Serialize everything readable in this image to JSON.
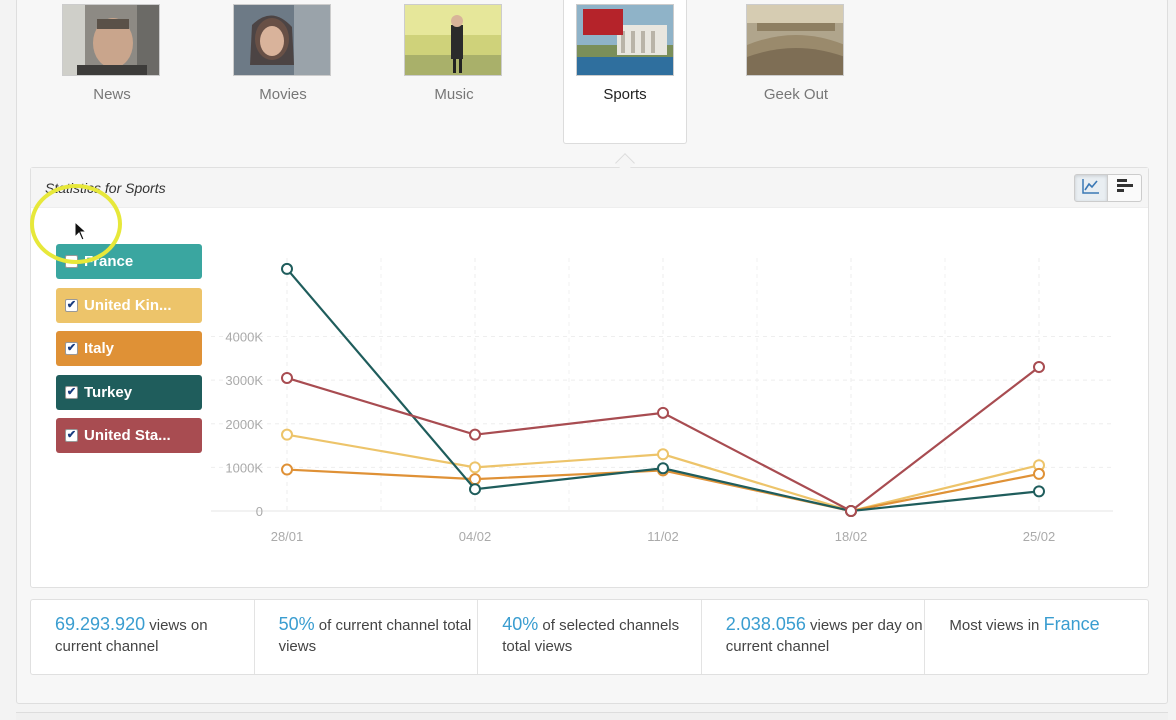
{
  "tabs": [
    {
      "label": "News",
      "active": false
    },
    {
      "label": "Movies",
      "active": false
    },
    {
      "label": "Music",
      "active": false
    },
    {
      "label": "Sports",
      "active": true
    },
    {
      "label": "Geek Out",
      "active": false
    }
  ],
  "panel": {
    "title": "Statistics for Sports"
  },
  "view_buttons": [
    {
      "icon": "line-chart-icon",
      "active": true
    },
    {
      "icon": "bar-chart-icon",
      "active": false
    }
  ],
  "legend": [
    {
      "label": "France",
      "checked": false,
      "color": "#3aa6a0"
    },
    {
      "label": "United Kin...",
      "checked": true,
      "color": "#edc46a"
    },
    {
      "label": "Italy",
      "checked": true,
      "color": "#df9136"
    },
    {
      "label": "Turkey",
      "checked": true,
      "color": "#1f5d5c"
    },
    {
      "label": "United Sta...",
      "checked": true,
      "color": "#a84c51"
    }
  ],
  "chart_data": {
    "type": "line",
    "x": [
      "28/01",
      "04/02",
      "11/02",
      "18/02",
      "25/02"
    ],
    "ytick_labels": [
      "0",
      "1000K",
      "2000K",
      "3000K",
      "4000K"
    ],
    "ytick_values": [
      0,
      1000,
      2000,
      3000,
      4000
    ],
    "ylim": [
      0,
      5800
    ],
    "grid": true,
    "series": [
      {
        "name": "United Kin...",
        "color": "#edc46a",
        "values": [
          1750,
          1000,
          1300,
          0,
          1050
        ]
      },
      {
        "name": "Italy",
        "color": "#df9136",
        "values": [
          950,
          730,
          930,
          0,
          850
        ]
      },
      {
        "name": "Turkey",
        "color": "#1f5d5c",
        "values": [
          5550,
          500,
          980,
          0,
          450
        ]
      },
      {
        "name": "United Sta...",
        "color": "#a84c51",
        "values": [
          3050,
          1750,
          2250,
          0,
          3300
        ]
      }
    ]
  },
  "summary": [
    {
      "value": "69.293.920",
      "text": " views on current channel"
    },
    {
      "value": "50%",
      "text": " of current channel total views"
    },
    {
      "value": "40%",
      "text": " of selected channels total views"
    },
    {
      "value": "2.038.056",
      "text": " views per day on current channel"
    },
    {
      "prefix": "Most views in ",
      "value": "France"
    }
  ]
}
